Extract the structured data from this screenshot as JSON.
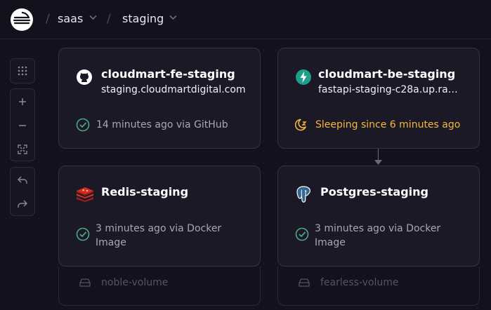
{
  "breadcrumb": {
    "project": "saas",
    "environment": "staging",
    "separator": "/"
  },
  "toolbar": {
    "grid_icon": "grid-dots-icon",
    "zoom_in_icon": "plus-icon",
    "zoom_out_icon": "minus-icon",
    "fit_icon": "fit-screen-icon",
    "undo_icon": "undo-icon",
    "redo_icon": "redo-icon"
  },
  "services": [
    {
      "name": "cloudmart-fe-staging",
      "url": "staging.cloudmartdigital.com",
      "icon": "github-icon",
      "status": "14 minutes ago via GitHub",
      "status_type": "success"
    },
    {
      "name": "cloudmart-be-staging",
      "url": "fastapi-staging-c28a.up.rail...",
      "icon": "bolt-icon",
      "status": "Sleeping since 6 minutes ago",
      "status_type": "sleeping"
    },
    {
      "name": "Redis-staging",
      "url": "",
      "icon": "redis-icon",
      "status": "3 minutes ago via Docker Image",
      "status_type": "success",
      "volume": "noble-volume"
    },
    {
      "name": "Postgres-staging",
      "url": "",
      "icon": "postgres-icon",
      "status": "3 minutes ago via Docker Image",
      "status_type": "success",
      "volume": "fearless-volume"
    }
  ],
  "colors": {
    "background": "#13111c",
    "card": "#1b1926",
    "success": "#4ea784",
    "sleeping": "#f4b73e",
    "redis": "#d82c20",
    "bolt": "#1f9e8c"
  }
}
